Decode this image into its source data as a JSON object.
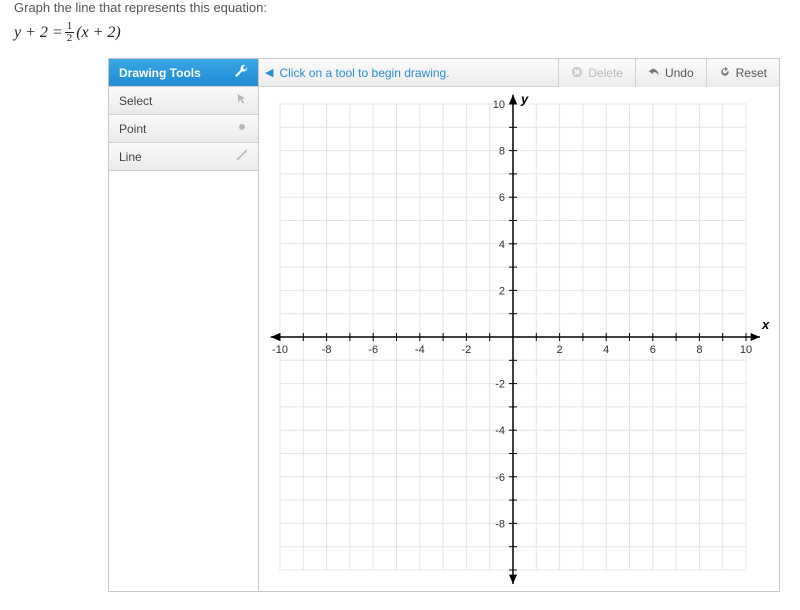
{
  "question_text": "Graph the line that represents this equation:",
  "equation": {
    "lhs": "y + 2 = ",
    "frac_num": "1",
    "frac_den": "2",
    "rhs": "(x + 2)"
  },
  "sidebar": {
    "title": "Drawing Tools",
    "items": [
      {
        "label": "Select",
        "icon": "cursor-icon"
      },
      {
        "label": "Point",
        "icon": "dot-icon"
      },
      {
        "label": "Line",
        "icon": "line-icon"
      }
    ]
  },
  "topbar": {
    "instruction": "Click on a tool to begin drawing."
  },
  "actions": {
    "delete_label": "Delete",
    "undo_label": "Undo",
    "reset_label": "Reset"
  },
  "chart_data": {
    "type": "scatter",
    "title": "",
    "xlabel": "x",
    "ylabel": "y",
    "xlim": [
      -10,
      10
    ],
    "ylim": [
      -10,
      10
    ],
    "x_ticks": [
      -10,
      -8,
      -6,
      -4,
      -2,
      2,
      4,
      6,
      8,
      10
    ],
    "y_ticks": [
      -8,
      -6,
      -4,
      -2,
      2,
      4,
      6,
      8,
      10
    ],
    "grid": true,
    "series": []
  }
}
